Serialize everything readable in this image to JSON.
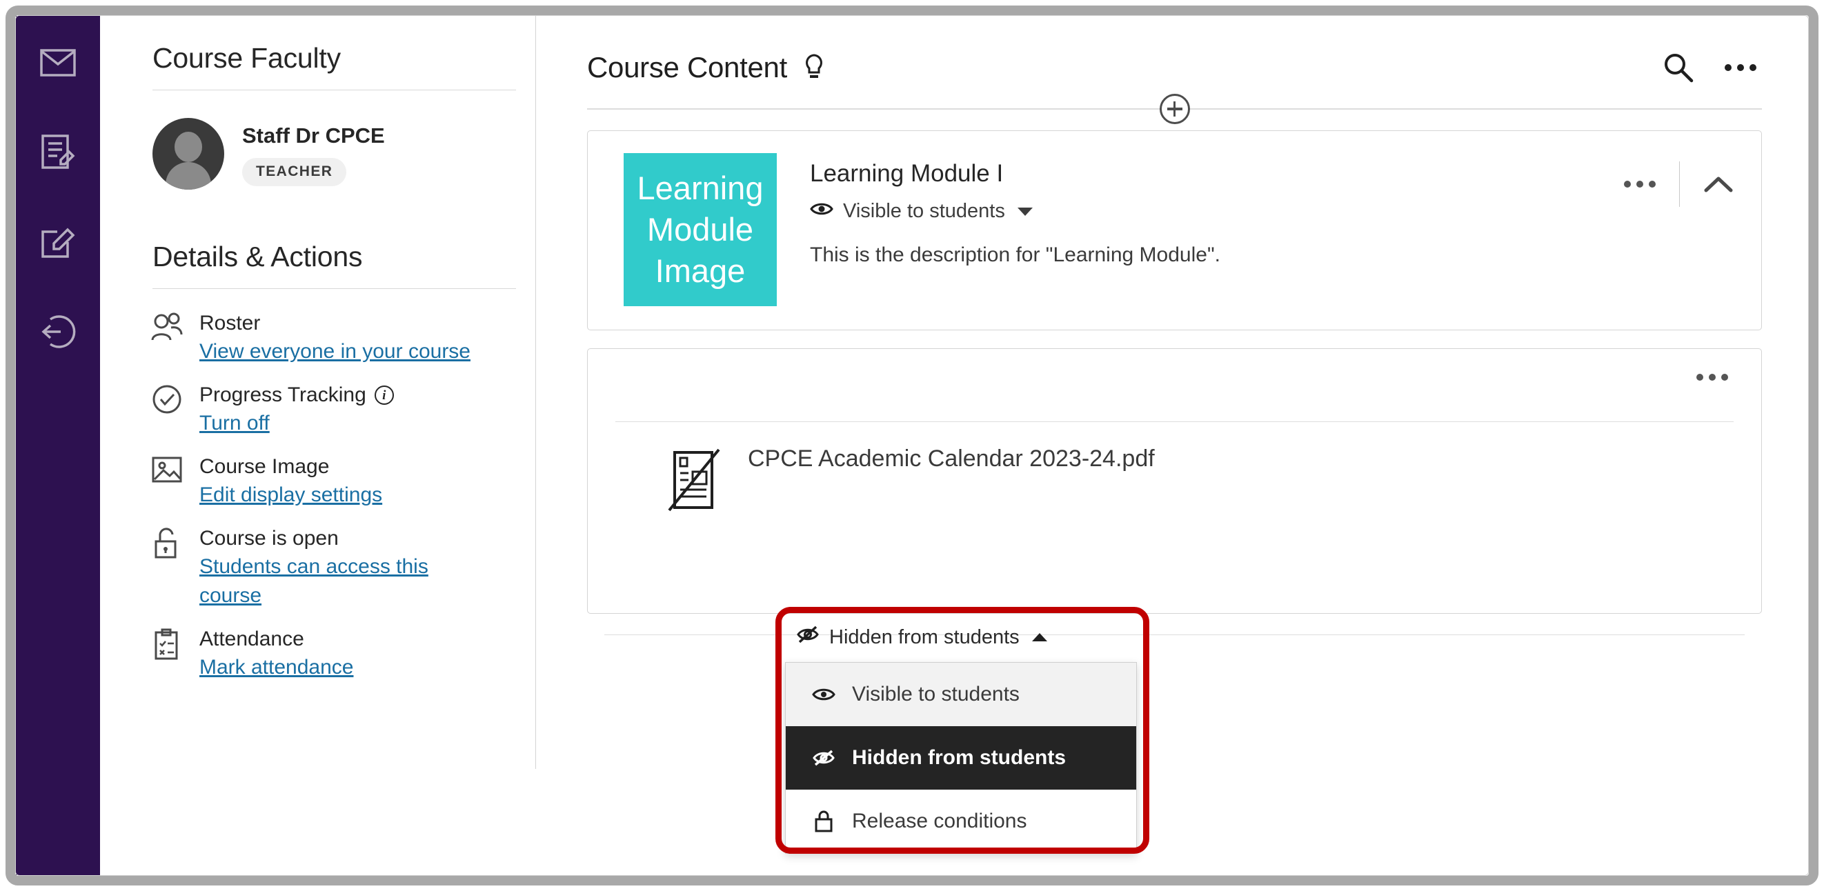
{
  "window": {
    "frame_color": "#a8a8a8"
  },
  "nav_rail": {
    "background": "#2d1150",
    "items": [
      {
        "icon": "envelope-icon",
        "label": "Messages"
      },
      {
        "icon": "document-edit-icon",
        "label": "Grades"
      },
      {
        "icon": "compose-icon",
        "label": "Compose"
      },
      {
        "icon": "sign-out-icon",
        "label": "Sign out"
      }
    ]
  },
  "sidebar": {
    "faculty_heading": "Course Faculty",
    "faculty": {
      "name": "Staff Dr CPCE",
      "role_badge": "TEACHER"
    },
    "details_heading": "Details & Actions",
    "details": [
      {
        "icon": "roster-people-icon",
        "title": "Roster",
        "link": "View everyone in your course",
        "info": false
      },
      {
        "icon": "check-circle-icon",
        "title": "Progress Tracking",
        "link": "Turn off",
        "info": true,
        "info_glyph": "i"
      },
      {
        "icon": "image-icon",
        "title": "Course Image",
        "link": "Edit display settings",
        "info": false
      },
      {
        "icon": "unlock-icon",
        "title": "Course is open",
        "link": "Students can access this course",
        "info": false
      },
      {
        "icon": "clipboard-check-icon",
        "title": "Attendance",
        "link": "Mark attendance",
        "info": false
      }
    ]
  },
  "main": {
    "title": "Course Content",
    "bulb_icon": "lightbulb-icon",
    "search_icon": "search-icon",
    "overflow_icon": "ellipsis-icon",
    "add_content_icon": "plus-circle-icon",
    "module": {
      "thumb_text": "Learning Module Image",
      "thumb_color": "#31cbcb",
      "title": "Learning Module I",
      "visibility": "Visible to students",
      "visibility_icon": "eye-icon",
      "description": "This is the description for \"Learning Module\".",
      "overflow_icon": "ellipsis-icon",
      "collapse_icon": "chevron-up-icon"
    },
    "file": {
      "icon": "document-hidden-icon",
      "name": "CPCE Academic Calendar 2023-24.pdf",
      "overflow_icon": "ellipsis-icon"
    }
  },
  "visibility_dropdown": {
    "trigger_label": "Hidden from students",
    "trigger_icon": "eye-slash-icon",
    "trigger_caret": "caret-up-icon",
    "options": [
      {
        "label": "Visible to students",
        "icon": "eye-icon",
        "state": "hover"
      },
      {
        "label": "Hidden from students",
        "icon": "eye-slash-icon",
        "state": "selected"
      },
      {
        "label": "Release conditions",
        "icon": "lock-icon",
        "state": "normal"
      }
    ]
  },
  "annotation": {
    "color": "#c00000",
    "shape": "rounded-rectangle"
  }
}
